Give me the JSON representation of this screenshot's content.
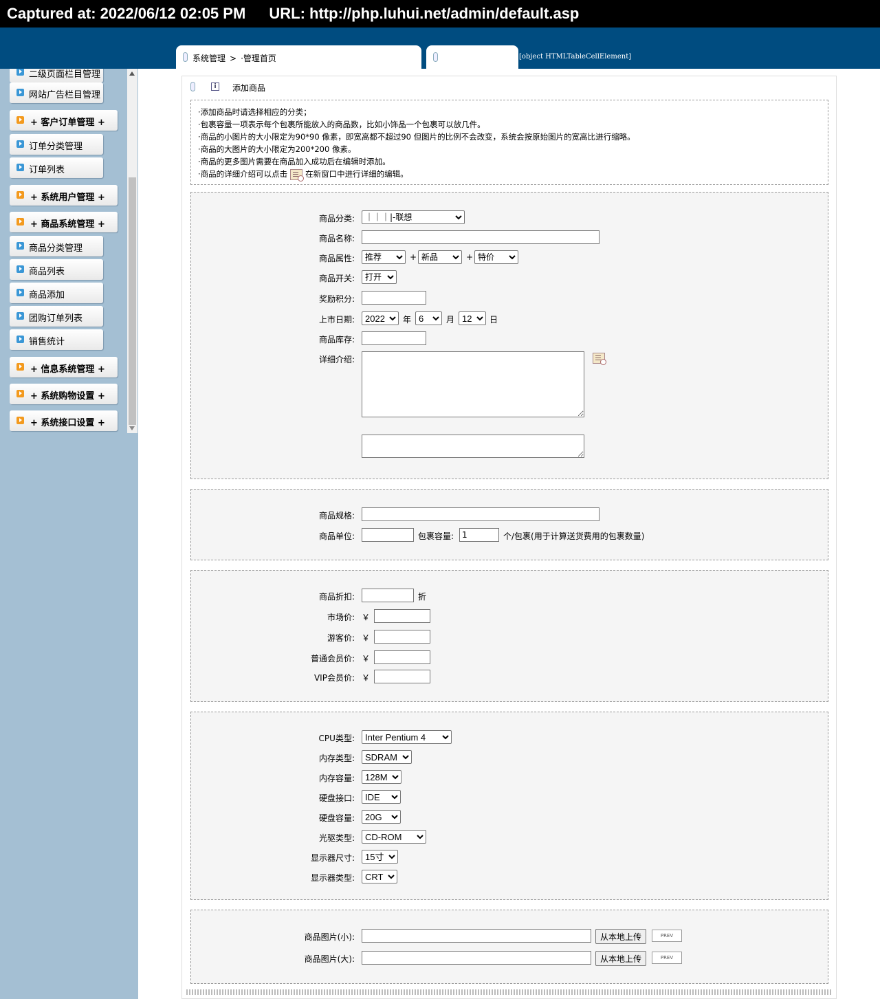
{
  "capture": {
    "captured_label": "Captured at: 2022/06/12 02:05 PM",
    "url_label": "URL: http://php.luhui.net/admin/default.asp"
  },
  "topnav": {
    "breadcrumb": [
      "系统管理",
      "·管理首页"
    ],
    "separator": ">",
    "second_tab_text": "[object HTMLTableCellElement]"
  },
  "sidebar": {
    "items": [
      {
        "label": "二级页面栏目管理",
        "type": "item"
      },
      {
        "label": "网站广告栏目管理",
        "type": "item"
      },
      {
        "label": "+ 客户订单管理 +",
        "type": "group"
      },
      {
        "label": "订单分类管理",
        "type": "item"
      },
      {
        "label": "订单列表",
        "type": "item"
      },
      {
        "label": "+ 系统用户管理 +",
        "type": "group"
      },
      {
        "label": "+ 商品系统管理 +",
        "type": "group"
      },
      {
        "label": "商品分类管理",
        "type": "item"
      },
      {
        "label": "商品列表",
        "type": "item"
      },
      {
        "label": "商品添加",
        "type": "item"
      },
      {
        "label": "团购订单列表",
        "type": "item"
      },
      {
        "label": "销售统计",
        "type": "item"
      },
      {
        "label": "+ 信息系统管理 +",
        "type": "group"
      },
      {
        "label": "+ 系统购物设置 +",
        "type": "group"
      },
      {
        "label": "+ 系统接口设置 +",
        "type": "group"
      }
    ]
  },
  "main": {
    "title": "添加商品",
    "notes": [
      "·添加商品时请选择相应的分类；",
      "·包裹容量一项表示每个包裹所能放入的商品数，比如小饰品一个包裹可以放几件。",
      "·商品的小图片的大小限定为90*90 像素，即宽高都不超过90 但图片的比例不会改变，系统会按原始图片的宽高比进行缩略。",
      "·商品的大图片的大小限定为200*200 像素。",
      "·商品的更多图片需要在商品加入成功后在编辑时添加。"
    ],
    "note_last_before": "·商品的详细介绍可以点击",
    "note_last_after": "在新窗口中进行详细的编辑。"
  },
  "basic": {
    "category_label": "商品分类:",
    "category_value": "｜｜｜|-联想",
    "name_label": "商品名称:",
    "name_value": "",
    "attr_label": "商品属性:",
    "attr1": "推荐",
    "attr2": "新品",
    "attr3": "特价",
    "plus": "+",
    "switch_label": "商品开关:",
    "switch_value": "打开",
    "points_label": "奖励积分:",
    "points_value": "",
    "date_label": "上市日期:",
    "year": "2022",
    "year_unit": "年",
    "month": "6",
    "month_unit": "月",
    "day": "12",
    "day_unit": "日",
    "stock_label": "商品库存:",
    "stock_value": "",
    "detail_label": "详细介绍:"
  },
  "spec": {
    "spec_label": "商品规格:",
    "spec_value": "",
    "unit_label": "商品单位:",
    "unit_value": "",
    "capacity_label": "包裹容量:",
    "capacity_value": "1",
    "capacity_hint": "个/包裹(用于计算送货费用的包裹数量)"
  },
  "price": {
    "discount_label": "商品折扣:",
    "discount_value": "",
    "discount_unit": "折",
    "market_label": "市场价:",
    "guest_label": "游客价:",
    "member_label": "普通会员价:",
    "vip_label": "VIP会员价:",
    "currency": "￥"
  },
  "hardware": {
    "cpu_label": "CPU类型:",
    "cpu_value": "Inter Pentium 4",
    "mem_type_label": "内存类型:",
    "mem_type_value": "SDRAM",
    "mem_size_label": "内存容量:",
    "mem_size_value": "128M",
    "disk_if_label": "硬盘接口:",
    "disk_if_value": "IDE",
    "disk_size_label": "硬盘容量:",
    "disk_size_value": "20G",
    "optical_label": "光驱类型:",
    "optical_value": "CD-ROM",
    "monitor_size_label": "显示器尺寸:",
    "monitor_size_value": "15寸",
    "monitor_type_label": "显示器类型:",
    "monitor_type_value": "CRT"
  },
  "images": {
    "small_label": "商品图片(小):",
    "large_label": "商品图片(大):",
    "upload_label": "从本地上传",
    "prev_label": "PREV"
  }
}
